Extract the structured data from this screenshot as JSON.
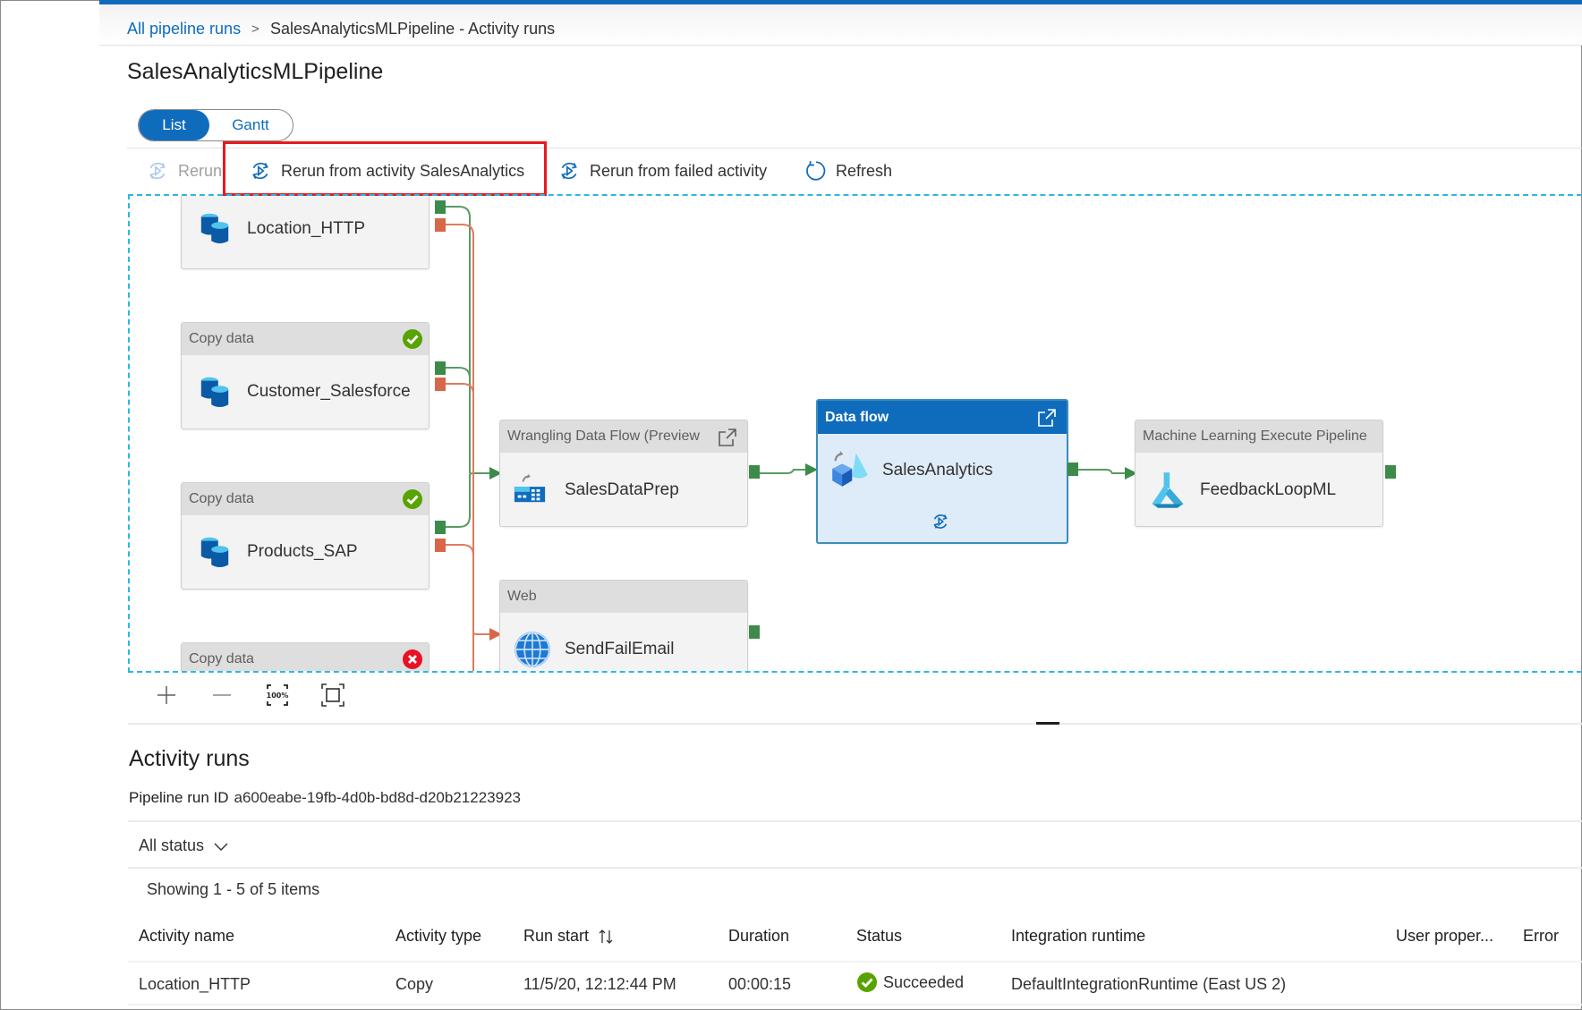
{
  "breadcrumb": {
    "link": "All pipeline runs",
    "separator": ">",
    "current": "SalesAnalyticsMLPipeline - Activity runs"
  },
  "page_title": "SalesAnalyticsMLPipeline",
  "view_toggle": {
    "options": [
      "List",
      "Gantt"
    ],
    "selected": "List"
  },
  "toolbar": {
    "rerun": "Rerun",
    "rerun_from_activity": "Rerun from activity SalesAnalytics",
    "rerun_from_failed": "Rerun from failed activity",
    "refresh": "Refresh"
  },
  "colors": {
    "accent": "#0f6cbd",
    "success_port": "#3d8b4b",
    "failure_port": "#d8674a",
    "highlight_box": "#e8191f",
    "canvas_border": "#2bb8e3"
  },
  "pipeline": {
    "nodes": [
      {
        "id": "location_http",
        "type": "",
        "name": "Location_HTTP",
        "icon": "database-icon",
        "status": ""
      },
      {
        "id": "customer_salesforce",
        "type": "Copy data",
        "name": "Customer_Salesforce",
        "icon": "database-icon",
        "status": "succeeded"
      },
      {
        "id": "products_sap",
        "type": "Copy data",
        "name": "Products_SAP",
        "icon": "database-icon",
        "status": "succeeded"
      },
      {
        "id": "copy4",
        "type": "Copy data",
        "name": "",
        "icon": "database-icon",
        "status": "failed"
      },
      {
        "id": "salesdataprep",
        "type": "Wrangling Data Flow (Preview",
        "name": "SalesDataPrep",
        "icon": "wrangling-dataflow-icon",
        "status": ""
      },
      {
        "id": "sendfailemail",
        "type": "Web",
        "name": "SendFailEmail",
        "icon": "globe-icon",
        "status": ""
      },
      {
        "id": "salesanalytics",
        "type": "Data flow",
        "name": "SalesAnalytics",
        "icon": "dataflow-icon",
        "status": "rerun-start",
        "selected": true
      },
      {
        "id": "feedbackloopml",
        "type": "Machine Learning Execute Pipeline",
        "name": "FeedbackLoopML",
        "icon": "ml-flask-icon",
        "status": ""
      }
    ],
    "zoom_controls": [
      "zoom-in",
      "zoom-out",
      "zoom-100",
      "fit-to-screen"
    ]
  },
  "activity_runs": {
    "title": "Activity runs",
    "run_id_label": "Pipeline run ID",
    "run_id": "a600eabe-19fb-4d0b-bd8d-d20b21223923",
    "filter": "All status",
    "count_text": "Showing 1 - 5 of 5 items",
    "columns": [
      "Activity name",
      "Activity type",
      "Run start",
      "Duration",
      "Status",
      "Integration runtime",
      "User proper...",
      "Error"
    ],
    "rows": [
      {
        "activity_name": "Location_HTTP",
        "activity_type": "Copy",
        "run_start": "11/5/20, 12:12:44 PM",
        "duration": "00:00:15",
        "status": "Succeeded",
        "integration_runtime": "DefaultIntegrationRuntime (East US 2)",
        "user_properties": "",
        "error": ""
      }
    ]
  }
}
